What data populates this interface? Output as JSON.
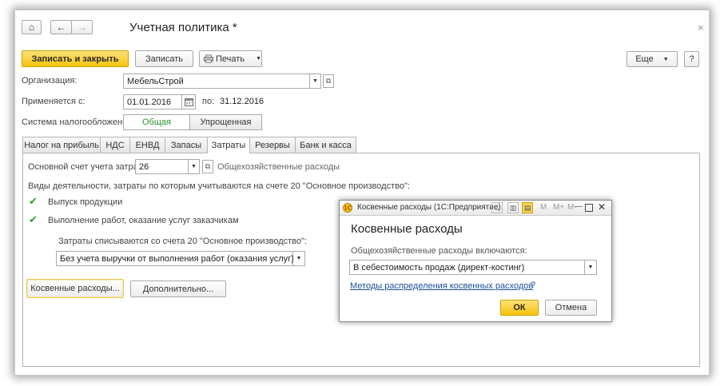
{
  "window": {
    "title": "Учетная политика *",
    "close_glyph": "×"
  },
  "nav": {
    "home": "⌂",
    "back": "←",
    "forward": "→"
  },
  "toolbar": {
    "save_close": "Записать и закрыть",
    "save": "Записать",
    "print": "Печать",
    "more": "Еще",
    "help": "?"
  },
  "form": {
    "org_label": "Организация:",
    "org_value": "МебельСтрой",
    "applies_label": "Применяется с:",
    "applies_from": "01.01.2016",
    "to_label": "по:",
    "applies_to": "31.12.2016",
    "tax_label": "Система налогообложения:",
    "tax_options": [
      "Общая",
      "Упрощенная"
    ]
  },
  "tabs": [
    "Налог на прибыль",
    "НДС",
    "ЕНВД",
    "Запасы",
    "Затраты",
    "Резервы",
    "Банк и касса"
  ],
  "costs": {
    "main_account_label": "Основной счет учета затрат:",
    "main_account_value": "26",
    "main_account_desc": "Общехозяйственные расходы",
    "activities_label": "Виды деятельности, затраты по которым учитываются на счете 20 \"Основное производство\":",
    "check1": "Выпуск продукции",
    "check2": "Выполнение работ, оказание услуг заказчикам",
    "writeoff_label": "Затраты списываются со счета 20 \"Основное производство\":",
    "writeoff_value": "Без учета выручки от выполнения работ (оказания услуг)",
    "indirect_button": "Косвенные расходы...",
    "additional_button": "Дополнительно..."
  },
  "dialog": {
    "window_title": "Косвенные расходы (1С:Предприятие)",
    "title_buttons": [
      "M",
      "M+",
      "M-"
    ],
    "heading": "Косвенные расходы",
    "field_label": "Общехозяйственные расходы включаются:",
    "field_value": "В себестоимость продаж (директ-костинг)",
    "link": "Методы распределения косвенных расходов",
    "help": "?",
    "ok": "ОК",
    "cancel": "Отмена"
  },
  "colors": {
    "primary": "#f5c40c",
    "tab_active_text": "#2f8f2f",
    "link": "#1a4f9c"
  }
}
